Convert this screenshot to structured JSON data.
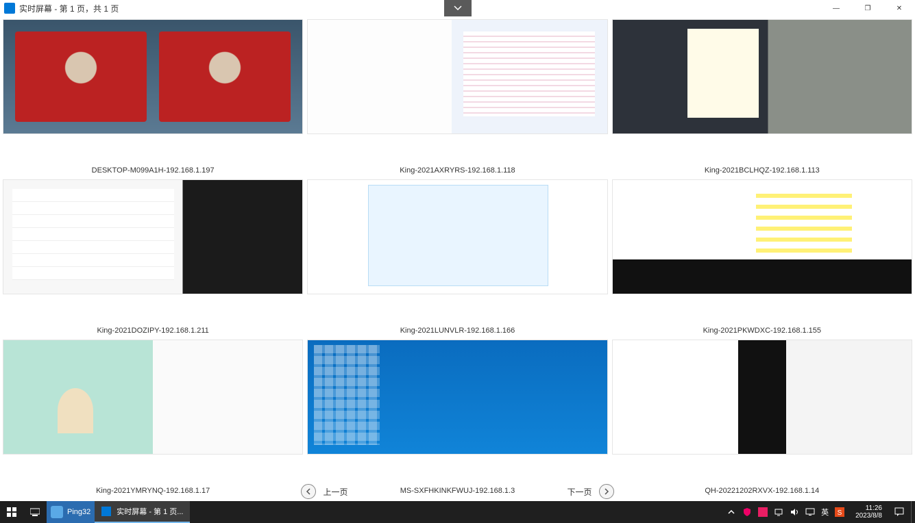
{
  "titlebar": {
    "title": "实时屏幕 - 第 1 页，共 1 页"
  },
  "window_controls": {
    "minimize": "—",
    "maximize": "❐",
    "close": "✕"
  },
  "screens": [
    {
      "label": "DESKTOP-M099A1H-192.168.1.197"
    },
    {
      "label": "King-2021AXRYRS-192.168.1.118"
    },
    {
      "label": "King-2021BCLHQZ-192.168.1.113"
    },
    {
      "label": "King-2021DOZIPY-192.168.1.211"
    },
    {
      "label": "King-2021LUNVLR-192.168.1.166"
    },
    {
      "label": "King-2021PKWDXC-192.168.1.155"
    },
    {
      "label": "King-2021YMRYNQ-192.168.1.17"
    },
    {
      "label": "MS-SXFHKINKFWUJ-192.168.1.3"
    },
    {
      "label": "QH-20221202RXVX-192.168.1.14"
    }
  ],
  "pager": {
    "prev": "上一页",
    "next": "下一页"
  },
  "taskbar": {
    "pinned_app": "Ping32",
    "running_app": "实时屏幕 - 第 1 页...",
    "ime": "英",
    "time": "11:26",
    "date": "2023/8/8"
  }
}
